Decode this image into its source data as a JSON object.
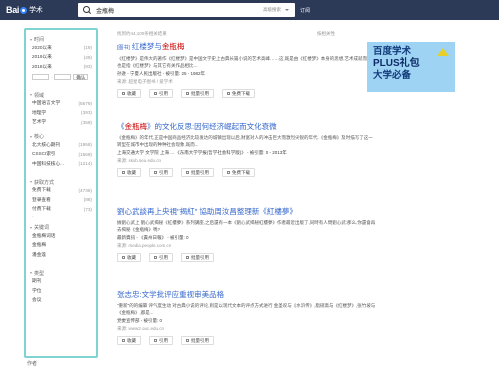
{
  "header": {
    "logo_text": "Bai",
    "logo_suffix": "学术",
    "search_query": "金瓶梅",
    "advanced_label": "高级搜索",
    "subscribe_label": "订阅"
  },
  "sidebar": {
    "sections": [
      {
        "title": "时间",
        "items": [
          {
            "label": "2020以来",
            "count": "(19)"
          },
          {
            "label": "2019以来",
            "count": "(49)"
          },
          {
            "label": "2018以来",
            "count": "(93)"
          }
        ],
        "range_confirm": "确认"
      },
      {
        "title": "领域",
        "items": [
          {
            "label": "中国语言文学",
            "count": "(5679)"
          },
          {
            "label": "地理学",
            "count": "(393)"
          },
          {
            "label": "艺术学",
            "count": "(359)"
          }
        ]
      },
      {
        "title": "核心",
        "items": [
          {
            "label": "北大核心期刊",
            "count": "(1958)"
          },
          {
            "label": "CSSCI索引",
            "count": "(1569)"
          },
          {
            "label": "中国科技核心...",
            "count": "(1214)"
          }
        ]
      },
      {
        "title": "获取方式",
        "items": [
          {
            "label": "免费下载",
            "count": "(4736)"
          },
          {
            "label": "登录查看",
            "count": "(88)"
          },
          {
            "label": "付费下载",
            "count": "(73)"
          }
        ]
      },
      {
        "title": "关键词",
        "items": [
          {
            "label": "金瓶梅词话",
            "count": ""
          },
          {
            "label": "金瓶梅",
            "count": ""
          },
          {
            "label": "潘金莲",
            "count": ""
          }
        ]
      },
      {
        "title": "类型",
        "items": [
          {
            "label": "期刊",
            "count": ""
          },
          {
            "label": "学位",
            "count": ""
          },
          {
            "label": "会议",
            "count": ""
          }
        ]
      }
    ],
    "footer_label": "作者"
  },
  "results_header": {
    "count_text": "找到约44,100条相关结果",
    "sort_text": "按相关性"
  },
  "results": [
    {
      "tag": "[图书]",
      "title_pre": "红楼梦与",
      "title_hl": "金瓶梅",
      "abstract": "《红楼梦》是伟大的著作《红楼梦》是中国文学史上古典长篇小说的艺术高峰……这,既是由《红楼梦》本身的思想,艺术成就而言,也是指《红楼梦》与其它有关作品相比...",
      "meta": "孙逊 - 宁夏人民出版社 - 被引量: 25 - 1982年",
      "src": "来源: 超星电子图书 / 爱学术",
      "buttons": [
        "收藏",
        "引用",
        "批量引用",
        "免费下载"
      ]
    },
    {
      "title_pre": "《",
      "title_hl": "金瓶梅",
      "title_post": "》的文化反思:因何经济崛起而文化衰微",
      "abstract": "《金瓶梅》的年代,正是中国商品经济比较发达的城镇出现以后,财富对人的冲击巨大而激烈尖锐的年代.《金瓶梅》及时描写了这一转型在城市中出现的种种社会现象,既而...",
      "meta": "上海交通大学 文学院 上海 ... 《东南大学学报(哲学社会科学版)》 - 被引量: 0 - 2013年",
      "src": "来源: skxb.seu.edu.cn",
      "buttons": [
        "收藏",
        "引用",
        "批量引用",
        "免费下载"
      ]
    },
    {
      "title": "劉心武談再上央視\"揭紅\" 協助周汝昌整理新《紅樓夢》",
      "abstract": "據劉心武上 劉心武揭秘《紅樓夢》系列講座,之后還有一本《劉心武揭秘紅樓夢》作者最近出版了,同時有人問劉心武:那么,你還會再去揭秘《金瓶梅》嗎?",
      "meta": "最新資訊 - 《貴州日報》 - 被引量: 0",
      "src": "來源: media.people.com.cn",
      "buttons": [
        "收藏",
        "引用",
        "批量引用"
      ]
    },
    {
      "title": "张志忠:文学批评应重视审美品格",
      "abstract": "\"重新\"的的编纂 评气度生动 对古典小说的评论,则是以现代文本的评点方式进行 金圣叹与《水浒传》,脂砚斋与《红楼梦》,张竹坡与《金瓶梅》,都是...",
      "meta": "党委宣传部 - 被引量: 0",
      "src": "来源: www2.ouc.edu.cn",
      "buttons": [
        "收藏",
        "引用",
        "批量引用"
      ]
    }
  ],
  "ad": {
    "line1": "百度学术",
    "line2": "PLUS礼包",
    "line3": "大学必备"
  }
}
